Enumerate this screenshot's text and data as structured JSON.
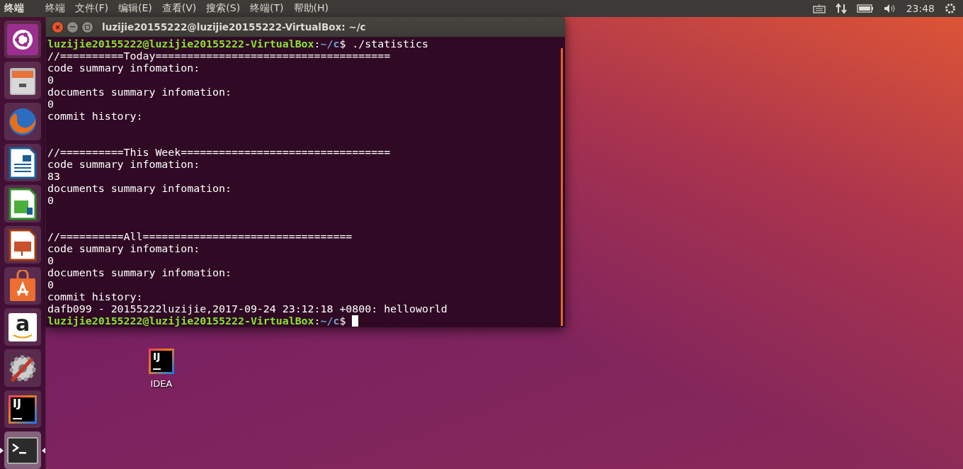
{
  "top_panel": {
    "app_name": "终端",
    "menu": [
      "终端",
      "文件(F)",
      "编辑(E)",
      "查看(V)",
      "搜索(S)",
      "终端(T)",
      "帮助(H)"
    ],
    "clock": "23:48"
  },
  "launcher": [
    {
      "kind": "ubuntu",
      "active": false
    },
    {
      "kind": "files",
      "active": false
    },
    {
      "kind": "firefox",
      "active": false
    },
    {
      "kind": "writer",
      "active": false
    },
    {
      "kind": "calc",
      "active": false
    },
    {
      "kind": "impress",
      "active": false
    },
    {
      "kind": "software",
      "active": false
    },
    {
      "kind": "amazon",
      "active": false,
      "glyph": "a"
    },
    {
      "kind": "settings",
      "active": false
    },
    {
      "kind": "idea",
      "active": false,
      "glyph": "IJ"
    },
    {
      "kind": "terminal",
      "active": true
    }
  ],
  "terminal": {
    "title": "luzijie20155222@luzijie20155222-VirtualBox: ~/c",
    "lines": [
      {
        "kind": "prompt",
        "user": "luzijie20155222@luzijie20155222-VirtualBox",
        "separator": ":",
        "path": "~/c",
        "symbol": "$",
        "command": "./statistics"
      },
      {
        "kind": "output",
        "text": "//==========Today====================================="
      },
      {
        "kind": "output",
        "text": "code summary infomation:"
      },
      {
        "kind": "output",
        "text": "0"
      },
      {
        "kind": "output",
        "text": "documents summary infomation:"
      },
      {
        "kind": "output",
        "text": "0"
      },
      {
        "kind": "output",
        "text": "commit history:"
      },
      {
        "kind": "blank"
      },
      {
        "kind": "blank"
      },
      {
        "kind": "output",
        "text": "//==========This Week================================="
      },
      {
        "kind": "output",
        "text": "code summary infomation:"
      },
      {
        "kind": "output",
        "text": "83"
      },
      {
        "kind": "output",
        "text": "documents summary infomation:"
      },
      {
        "kind": "output",
        "text": "0"
      },
      {
        "kind": "blank"
      },
      {
        "kind": "blank"
      },
      {
        "kind": "output",
        "text": "//==========All================================="
      },
      {
        "kind": "output",
        "text": "code summary infomation:"
      },
      {
        "kind": "output",
        "text": "0"
      },
      {
        "kind": "output",
        "text": "documents summary infomation:"
      },
      {
        "kind": "output",
        "text": "0"
      },
      {
        "kind": "output",
        "text": "commit history:"
      },
      {
        "kind": "output",
        "text": "dafb099 - 20155222luzijie,2017-09-24 23:12:18 +0800: helloworld"
      },
      {
        "kind": "prompt",
        "user": "luzijie20155222@luzijie20155222-VirtualBox",
        "separator": ":",
        "path": "~/c",
        "symbol": "$",
        "cursor": true
      }
    ]
  },
  "desktop_icons": [
    {
      "label": "IDEA",
      "glyph": "IJ"
    }
  ]
}
